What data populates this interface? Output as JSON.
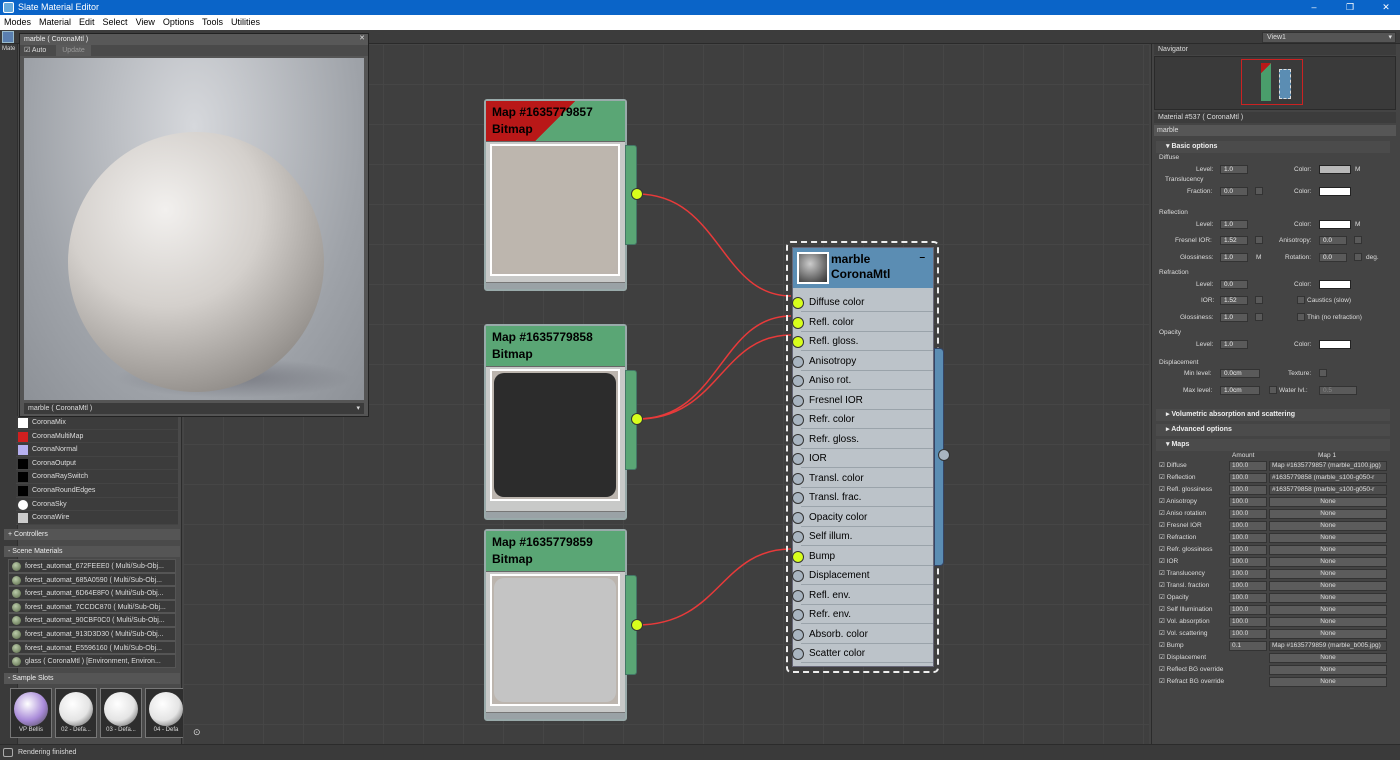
{
  "window": {
    "title": "Slate Material Editor",
    "controls": [
      "–",
      "❐",
      "✕"
    ]
  },
  "menu": [
    "Modes",
    "Material",
    "Edit",
    "Select",
    "View",
    "Options",
    "Tools",
    "Utilities"
  ],
  "view_dropdown": "View1",
  "preview": {
    "title": "marble  ( CoronaMtl )",
    "auto_label": "Auto",
    "update_label": "Update",
    "footer": "marble  ( CoronaMtl )"
  },
  "left_panel": {
    "tab_label": "Mate",
    "material_list": [
      {
        "label": "CoronaMix",
        "color": "#ffffff"
      },
      {
        "label": "CoronaMultiMap",
        "color": "#d11f1f"
      },
      {
        "label": "CoronaNormal",
        "color": "#b6b0f0"
      },
      {
        "label": "CoronaOutput",
        "color": "#000000"
      },
      {
        "label": "CoronaRaySwitch",
        "color": "#000000"
      },
      {
        "label": "CoronaRoundEdges",
        "color": "#000000"
      },
      {
        "label": "CoronaSky",
        "color": "#ffffff"
      },
      {
        "label": "CoronaWire",
        "color": "#cccccc"
      }
    ],
    "controllers_label": "+ Controllers",
    "scene_label": "- Scene Materials",
    "scene_materials": [
      "forest_automat_672FEEE0  ( Multi/Sub-Obj...",
      "forest_automat_685A0590  ( Multi/Sub-Obj...",
      "forest_automat_6D64E8F0  ( Multi/Sub-Obj...",
      "forest_automat_7CCDC870  ( Multi/Sub-Obj...",
      "forest_automat_90CBF0C0  ( Multi/Sub-Obj...",
      "forest_automat_913D3D30  ( Multi/Sub-Obj...",
      "forest_automat_E5596160  ( Multi/Sub-Obj...",
      "glass  ( CoronaMtl )  [Environment, Environ..."
    ],
    "sample_label": "- Sample Slots",
    "sample_slots": [
      {
        "label": "VP Bellis",
        "color": "#a88ad8"
      },
      {
        "label": "02 - Defa...",
        "color": "#e4e4e4"
      },
      {
        "label": "03 - Defa...",
        "color": "#e4e4e4"
      },
      {
        "label": "04 - Defa",
        "color": "#e4e4e4"
      }
    ]
  },
  "nodes": [
    {
      "title": "Map #1635779857",
      "subtitle": "Bitmap",
      "thumb": "#bdb6ae"
    },
    {
      "title": "Map #1635779858",
      "subtitle": "Bitmap",
      "thumb": "#2c2c2c"
    },
    {
      "title": "Map #1635779859",
      "subtitle": "Bitmap",
      "thumb": "#c4c4c4"
    }
  ],
  "material_node": {
    "name": "marble",
    "type": "CoronaMtl",
    "minimize": "–",
    "slots": [
      "Diffuse color",
      "Refl. color",
      "Refl. gloss.",
      "Anisotropy",
      "Aniso rot.",
      "Fresnel IOR",
      "Refr. color",
      "Refr. gloss.",
      "IOR",
      "Transl. color",
      "Transl. frac.",
      "Opacity color",
      "Self illum.",
      "Bump",
      "Displacement",
      "Refl. env.",
      "Refr. env.",
      "Absorb. color",
      "Scatter color"
    ],
    "connected": [
      "Diffuse color",
      "Refl. color",
      "Refl. gloss.",
      "Bump"
    ]
  },
  "navigator": {
    "title": "Navigator"
  },
  "params": {
    "title": "Material #537  ( CoronaMtl )",
    "name_field": "marble",
    "basic_options": "Basic options",
    "diffuse": "Diffuse",
    "level_label": "Level:",
    "color_label": "Color:",
    "m_label": "M",
    "translucency": "Translucency",
    "fraction_label": "Fraction:",
    "reflection": "Reflection",
    "fresnel_label": "Fresnel IOR:",
    "anisotropy_label": "Anisotropy:",
    "glossiness_label": "Glossiness:",
    "rotation_label": "Rotation:",
    "deg_label": "deg.",
    "refraction": "Refraction",
    "ior_label": "IOR:",
    "caustics_label": "Caustics (slow)",
    "thin_label": "Thin (no refraction)",
    "opacity": "Opacity",
    "displacement": "Displacement",
    "min_level_label": "Min level:",
    "max_level_label": "Max level:",
    "texture_label": "Texture:",
    "water_label": "Water lvl.:",
    "values": {
      "diffuse_level": "1.0",
      "diffuse_color": "#b8b8b8",
      "transl_fraction": "0.0",
      "transl_color": "#ffffff",
      "refl_level": "1.0",
      "refl_color": "#ffffff",
      "fresnel_ior": "1.52",
      "anisotropy": "0.0",
      "refl_gloss": "1.0",
      "rotation": "0.0",
      "refr_level": "0.0",
      "refr_color": "#ffffff",
      "ior": "1.52",
      "refr_gloss": "1.0",
      "opacity_level": "1.0",
      "opacity_color": "#ffffff",
      "min_level": "0.0cm",
      "max_level": "1.0cm",
      "water_level": "0.5"
    },
    "volumetric": "Volumetric absorption and scattering",
    "advanced": "Advanced options",
    "maps": "Maps",
    "amount_col": "Amount",
    "map_col": "Map 1",
    "map_rows": [
      {
        "label": "Diffuse",
        "amount": "100.0",
        "map": "Map #1635779857 (marble_d100.jpg)"
      },
      {
        "label": "Reflection",
        "amount": "100.0",
        "map": "#1635779858 (marble_s100-g050-r"
      },
      {
        "label": "Refl. glossiness",
        "amount": "100.0",
        "map": "#1635779858 (marble_s100-g050-r"
      },
      {
        "label": "Anisotropy",
        "amount": "100.0",
        "map": "None"
      },
      {
        "label": "Aniso rotation",
        "amount": "100.0",
        "map": "None"
      },
      {
        "label": "Fresnel IOR",
        "amount": "100.0",
        "map": "None"
      },
      {
        "label": "Refraction",
        "amount": "100.0",
        "map": "None"
      },
      {
        "label": "Refr. glossiness",
        "amount": "100.0",
        "map": "None"
      },
      {
        "label": "IOR",
        "amount": "100.0",
        "map": "None"
      },
      {
        "label": "Translucency",
        "amount": "100.0",
        "map": "None"
      },
      {
        "label": "Transl. fraction",
        "amount": "100.0",
        "map": "None"
      },
      {
        "label": "Opacity",
        "amount": "100.0",
        "map": "None"
      },
      {
        "label": "Self Illumination",
        "amount": "100.0",
        "map": "None"
      },
      {
        "label": "Vol. absorption",
        "amount": "100.0",
        "map": "None"
      },
      {
        "label": "Vol. scattering",
        "amount": "100.0",
        "map": "None"
      },
      {
        "label": "Bump",
        "amount": "0.1",
        "map": "Map #1635779859 (marble_b005.jpg)"
      },
      {
        "label": "Displacement",
        "amount": "",
        "map": "None"
      },
      {
        "label": "Reflect BG override",
        "amount": "",
        "map": "None"
      },
      {
        "label": "Refract BG override",
        "amount": "",
        "map": "None"
      }
    ]
  },
  "status": "Rendering finished"
}
